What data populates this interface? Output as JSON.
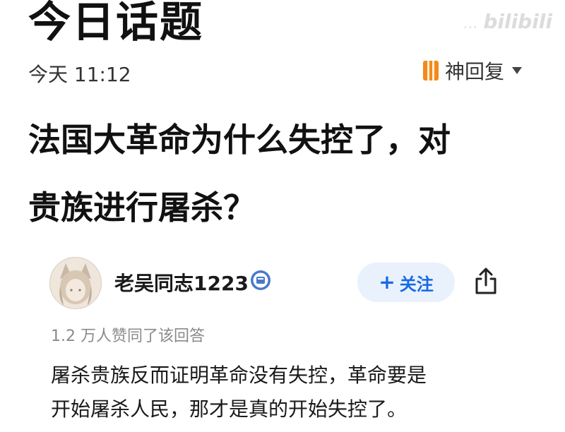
{
  "header": {
    "title": "今日话题",
    "watermark": "...",
    "watermark_logo": "bilibili"
  },
  "meta": {
    "time": "今天 11:12",
    "reply_label": "神回复"
  },
  "question": {
    "title_line1": "法国大革命为什么失控了，对",
    "title_line2": "贵族进行屠杀？"
  },
  "author": {
    "name": "老吴同志1223",
    "follow_label": "关注",
    "follow_plus": "+"
  },
  "answer": {
    "likes": "1.2 万人赞同了该回答",
    "line1": "屠杀贵族反而证明革命没有失控，革命要是",
    "line2": "开始屠杀人民，那才是真的开始失控了。"
  },
  "colors": {
    "accent": "#1769e6",
    "follow_bg": "#e9f1fd",
    "reply_icon": "#f28a1a",
    "muted": "#8a8a8a"
  },
  "icons": {
    "reply": "book-icon",
    "chevron": "chevron-down-icon",
    "verified": "verified-badge-icon",
    "share": "share-icon"
  }
}
